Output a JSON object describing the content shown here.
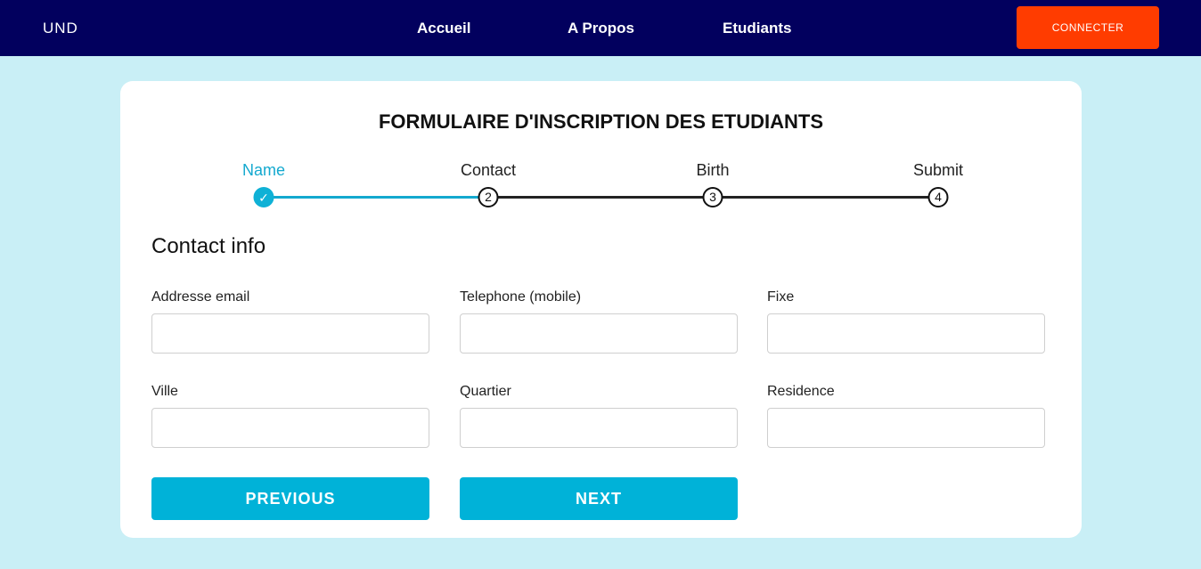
{
  "navbar": {
    "brand": "UND",
    "links": [
      "Accueil",
      "A Propos",
      "Etudiants"
    ],
    "connect_label": "CONNECTER",
    "background": "#02005e",
    "connect_color": "#ff3c00"
  },
  "form": {
    "title": "FORMULAIRE D'INSCRIPTION DES ETUDIANTS",
    "steps": [
      {
        "label": "Name",
        "marker": "✓",
        "status": "done"
      },
      {
        "label": "Contact",
        "marker": "2",
        "status": "current"
      },
      {
        "label": "Birth",
        "marker": "3",
        "status": "pending"
      },
      {
        "label": "Submit",
        "marker": "4",
        "status": "pending"
      }
    ],
    "section_title": "Contact info",
    "fields": [
      {
        "label": "Addresse email",
        "value": "",
        "placeholder": ""
      },
      {
        "label": "Telephone (mobile)",
        "value": "",
        "placeholder": ""
      },
      {
        "label": "Fixe",
        "value": "",
        "placeholder": ""
      },
      {
        "label": "Ville",
        "value": "",
        "placeholder": ""
      },
      {
        "label": "Quartier",
        "value": "",
        "placeholder": ""
      },
      {
        "label": "Residence",
        "value": "",
        "placeholder": ""
      }
    ],
    "previous_label": "PREVIOUS",
    "next_label": "NEXT",
    "accent_color": "#00b2d8"
  }
}
